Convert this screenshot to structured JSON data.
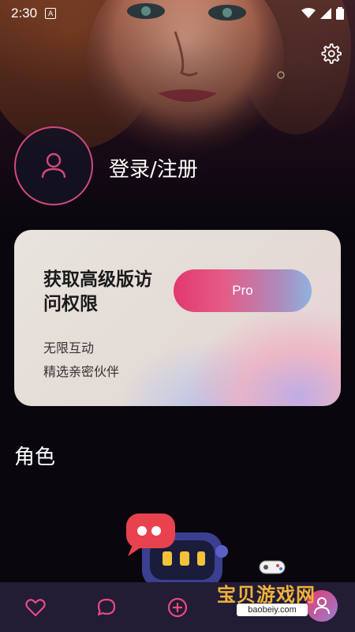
{
  "status_bar": {
    "time": "2:30",
    "notification_glyph": "A"
  },
  "header": {
    "settings_icon": "gear-icon"
  },
  "profile": {
    "avatar_icon": "user-icon",
    "login_label": "登录/注册"
  },
  "pro_card": {
    "title": "获取高级版访问权限",
    "button_label": "Pro",
    "features": [
      "无限互动",
      "精选亲密伙伴"
    ]
  },
  "section": {
    "title": "角色"
  },
  "bottom_nav": {
    "items": [
      {
        "icon": "heart-icon"
      },
      {
        "icon": "chat-bubble-icon"
      },
      {
        "icon": "add-circle-icon"
      },
      {
        "icon": "profile-icon"
      }
    ]
  },
  "watermark": {
    "text": "宝贝游戏网",
    "url": "baobeiy.com"
  },
  "colors": {
    "accent": "#d04a7c",
    "nav_bg": "#221c35",
    "background": "#09070d",
    "pro_gradient_start": "#e2386f",
    "pro_gradient_end": "#8fb2e0"
  }
}
